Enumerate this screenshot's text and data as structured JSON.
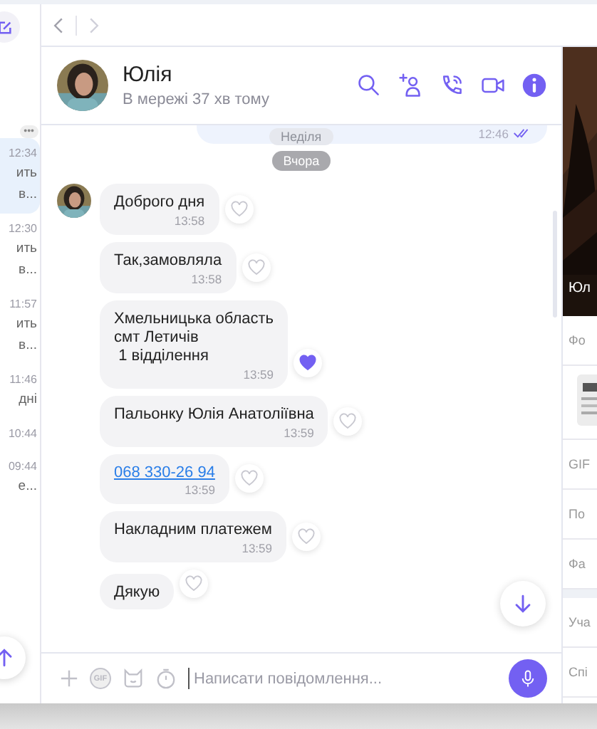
{
  "chat_list": {
    "more_button": "•••",
    "items": [
      {
        "time": "12:34",
        "lines": [
          "ить",
          "в..."
        ],
        "selected": true
      },
      {
        "time": "12:30",
        "lines": [
          "ить",
          "в..."
        ],
        "selected": false
      },
      {
        "time": "11:57",
        "lines": [
          "ить",
          "в..."
        ],
        "selected": false
      },
      {
        "time": "11:46",
        "lines": [
          "дні"
        ],
        "selected": false
      },
      {
        "time": "10:44",
        "selected": false
      },
      {
        "time": "09:44",
        "lines": [
          "е..."
        ],
        "selected": false
      }
    ]
  },
  "header": {
    "name": "Юлія",
    "status": "В мережі 37 хв тому"
  },
  "outgoing_tail": {
    "time": "12:46",
    "read": true
  },
  "date_overlay": "Неділя",
  "date_separator": "Вчора",
  "messages": [
    {
      "kind": "text",
      "text": "Доброго дня",
      "time": "13:58",
      "liked": false,
      "avatar": true
    },
    {
      "kind": "text",
      "text": "Так,замовляла",
      "time": "13:58",
      "liked": false,
      "avatar": false
    },
    {
      "kind": "text",
      "text": "Хмельницька область\nсмт Летичів\n 1 відділення",
      "time": "13:59",
      "liked": true,
      "avatar": false
    },
    {
      "kind": "text",
      "text": "Пальонку Юлія Анатоліївна",
      "time": "13:59",
      "liked": false,
      "avatar": false
    },
    {
      "kind": "link",
      "text": "068 330-26 94",
      "time": "13:59",
      "liked": false,
      "avatar": false
    },
    {
      "kind": "text",
      "text": "Накладним платежем",
      "time": "13:59",
      "liked": false,
      "avatar": false
    },
    {
      "kind": "text",
      "text": "Дякую",
      "liked": false,
      "avatar": false
    }
  ],
  "composer": {
    "gif_label": "GIF",
    "placeholder": "Написати повідомлення..."
  },
  "info_panel": {
    "photo_caption": "Юл",
    "sections": [
      {
        "kind": "row",
        "text": "Фо"
      },
      {
        "kind": "thumbnail"
      },
      {
        "kind": "row",
        "text": "GIF"
      },
      {
        "kind": "row",
        "text": "По"
      },
      {
        "kind": "row",
        "text": "Фа"
      },
      {
        "kind": "gap"
      },
      {
        "kind": "row",
        "text": "Уча"
      },
      {
        "kind": "row",
        "text": "Спі"
      }
    ]
  }
}
